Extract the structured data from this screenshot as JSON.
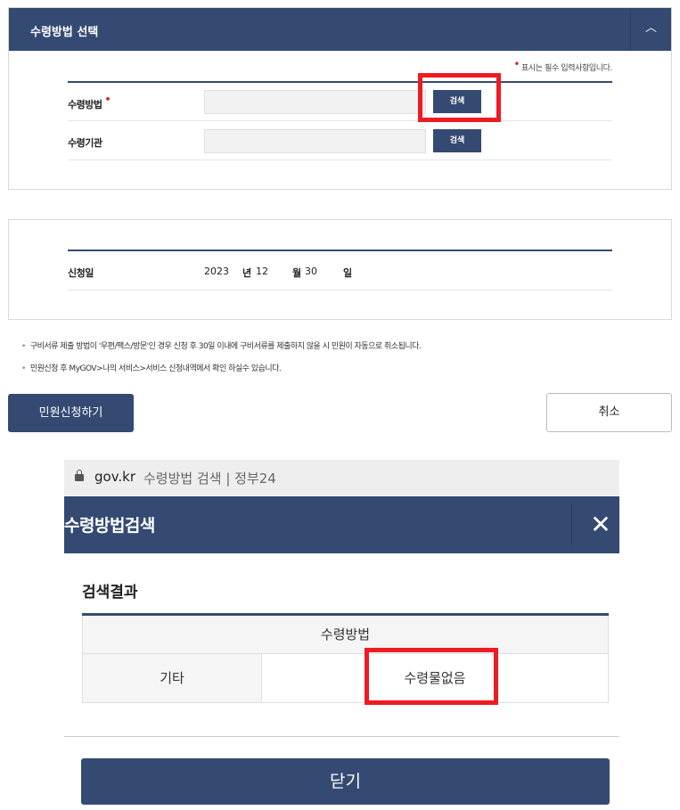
{
  "section1": {
    "title": "수령방법 선택",
    "toggle_glyph": "︿",
    "required_star": "•",
    "required_note": "표시는 필수 입력사항입니다.",
    "rows": [
      {
        "label": "수령방법",
        "required_mark": "•",
        "value": "",
        "button": "검색"
      },
      {
        "label": "수령기관",
        "value": "",
        "button": "검색"
      }
    ]
  },
  "section2": {
    "date_label": "신청일",
    "year": "2023",
    "year_unit": "년",
    "month": "12",
    "month_unit": "월",
    "day": "30",
    "day_unit": "일"
  },
  "notices": [
    "구비서류 제출 방법이 '우편/팩스/방문'인 경우 신청 후 30일 이내에 구비서류를 제출하지 않을 시 민원이 자동으로 취소됩니다.",
    "민원신청 후 MyGOV>나의 서비스>서비스 신청내역에서 확인 하실수 있습니다."
  ],
  "notice_bullet": "•",
  "buttons": {
    "apply": "민원신청하기",
    "cancel": "취소"
  },
  "popup": {
    "url_domain": "gov.kr",
    "url_title": "수령방법 검색 | 정부24",
    "title": "수령방법검색",
    "close_glyph": "✕",
    "result_title": "검색결과",
    "table_header": "수령방법",
    "row_left": "기타",
    "row_right": "수령물없음",
    "close_button": "닫기"
  },
  "colors": {
    "navy": "#344a72",
    "highlight": "#ee1b22",
    "required": "#d8222a"
  }
}
